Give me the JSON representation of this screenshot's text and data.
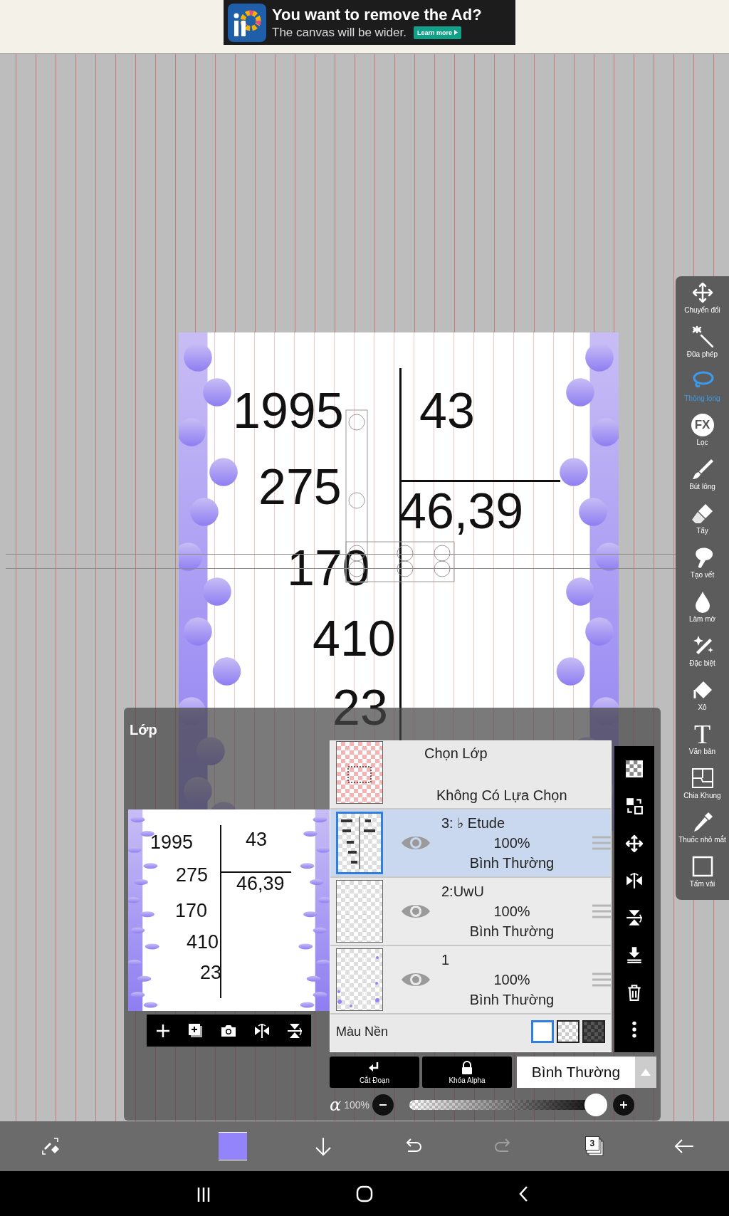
{
  "ad": {
    "headline": "You want to remove the Ad?",
    "subline": "The canvas will be wider.",
    "button": "Learn more"
  },
  "artwork": {
    "dividend_steps": [
      "1995",
      "275",
      "170",
      "410",
      "23"
    ],
    "divisor": "43",
    "quotient": "46,39"
  },
  "tools": [
    {
      "label": "Chuyển đổi",
      "selected": false
    },
    {
      "label": "Đũa phép",
      "selected": false
    },
    {
      "label": "Thòng lọng",
      "selected": true
    },
    {
      "glyph": "FX",
      "label": "Lọc",
      "selected": false
    },
    {
      "label": "Bút lông",
      "selected": false
    },
    {
      "label": "Tẩy",
      "selected": false
    },
    {
      "label": "Tạo vết",
      "selected": false
    },
    {
      "label": "Làm mờ",
      "selected": false
    },
    {
      "label": "Đặc biệt",
      "selected": false
    },
    {
      "label": "Xô",
      "selected": false
    },
    {
      "glyph": "T",
      "label": "Văn bản",
      "selected": false
    },
    {
      "label": "Chia Khung",
      "selected": false
    },
    {
      "label": "Thuốc nhỏ mắt",
      "selected": false
    },
    {
      "label": "Tấm vải",
      "selected": false
    }
  ],
  "layer_panel": {
    "title": "Lớp",
    "preview": {
      "dividend_steps": [
        "1995",
        "275",
        "170",
        "410",
        "23"
      ],
      "divisor": "43",
      "quotient": "46,39"
    },
    "selection_row": {
      "title": "Chọn Lớp",
      "status": "Không Có Lựa Chọn"
    },
    "layers": [
      {
        "name": "3: ♭ Etude",
        "opacity": "100%",
        "blend": "Bình Thường",
        "visible": true,
        "selected": true
      },
      {
        "name": "2:UwU",
        "opacity": "100%",
        "blend": "Bình Thường",
        "visible": true,
        "selected": false
      },
      {
        "name": "1",
        "opacity": "100%",
        "blend": "Bình Thường",
        "visible": true,
        "selected": false
      }
    ],
    "background": {
      "label": "Màu Nền",
      "options": [
        {
          "kind": "white",
          "selected": true
        },
        {
          "kind": "transparent",
          "selected": false
        },
        {
          "kind": "dark",
          "selected": false
        }
      ]
    },
    "buttons": [
      {
        "label": "Cắt Đoạn"
      },
      {
        "label": "Khóa Alpha"
      }
    ],
    "blend_mode": "Bình Thường",
    "opacity": {
      "symbol": "α",
      "reading": "100%",
      "level": 1
    }
  },
  "bottom_bar": [
    {
      "kind": "brush-swap",
      "disabled": false
    },
    {
      "kind": "color",
      "color": "#9384fc",
      "disabled": false
    },
    {
      "kind": "down",
      "disabled": false
    },
    {
      "kind": "undo",
      "disabled": false
    },
    {
      "kind": "redo",
      "disabled": true
    },
    {
      "kind": "layers",
      "count": "3",
      "disabled": false
    },
    {
      "kind": "back",
      "disabled": false
    }
  ]
}
